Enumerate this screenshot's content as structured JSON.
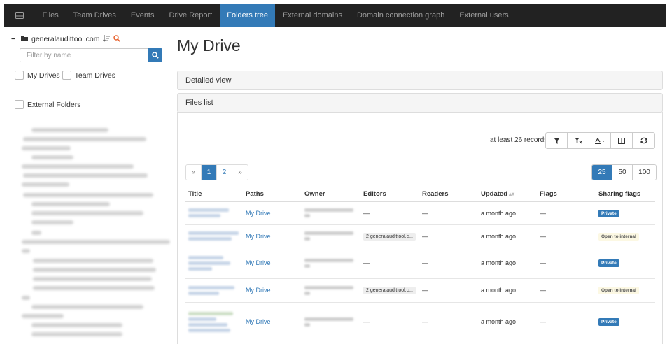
{
  "nav": {
    "items": [
      {
        "label": "Files",
        "active": false
      },
      {
        "label": "Team Drives",
        "active": false
      },
      {
        "label": "Events",
        "active": false
      },
      {
        "label": "Drive Report",
        "active": false
      },
      {
        "label": "Folders tree",
        "active": true
      },
      {
        "label": "External domains",
        "active": false
      },
      {
        "label": "Domain connection graph",
        "active": false
      },
      {
        "label": "External users",
        "active": false
      }
    ],
    "home_icon": "drive-icon"
  },
  "sidebar": {
    "root_label": "generalaudittool.com",
    "filter_placeholder": "Filter by name",
    "my_drives_label": "My Drives",
    "team_drives_label": "Team Drives",
    "external_folders_label": "External Folders"
  },
  "main": {
    "title": "My Drive",
    "detailed_view_label": "Detailed view",
    "files_list_label": "Files list",
    "records_text": "at least 26 records",
    "pagination": {
      "prev": "«",
      "pages": [
        "1",
        "2"
      ],
      "current": "1",
      "next": "»"
    },
    "page_sizes": [
      "25",
      "50",
      "100"
    ],
    "page_size_selected": "25",
    "table": {
      "headers": {
        "title": "Title",
        "paths": "Paths",
        "owner": "Owner",
        "editors": "Editors",
        "readers": "Readers",
        "updated": "Updated",
        "flags": "Flags",
        "sharing_flags": "Sharing flags"
      },
      "rows": [
        {
          "path": "My Drive",
          "editors": "—",
          "readers": "—",
          "updated": "a month ago",
          "flags": "—",
          "sharing": "Private"
        },
        {
          "path": "My Drive",
          "editors": "2 generalaudittool.c...",
          "readers": "—",
          "updated": "a month ago",
          "flags": "—",
          "sharing": "Open to internal"
        },
        {
          "path": "My Drive",
          "editors": "—",
          "readers": "—",
          "updated": "a month ago",
          "flags": "—",
          "sharing": "Private"
        },
        {
          "path": "My Drive",
          "editors": "2 generalaudittool.c...",
          "readers": "—",
          "updated": "a month ago",
          "flags": "—",
          "sharing": "Open to internal"
        },
        {
          "path": "My Drive",
          "editors": "—",
          "readers": "—",
          "updated": "a month ago",
          "flags": "—",
          "sharing": "Private"
        }
      ]
    }
  },
  "colors": {
    "accent": "#337ab7",
    "navbar": "#222222",
    "search_icon": "#e8612c"
  }
}
